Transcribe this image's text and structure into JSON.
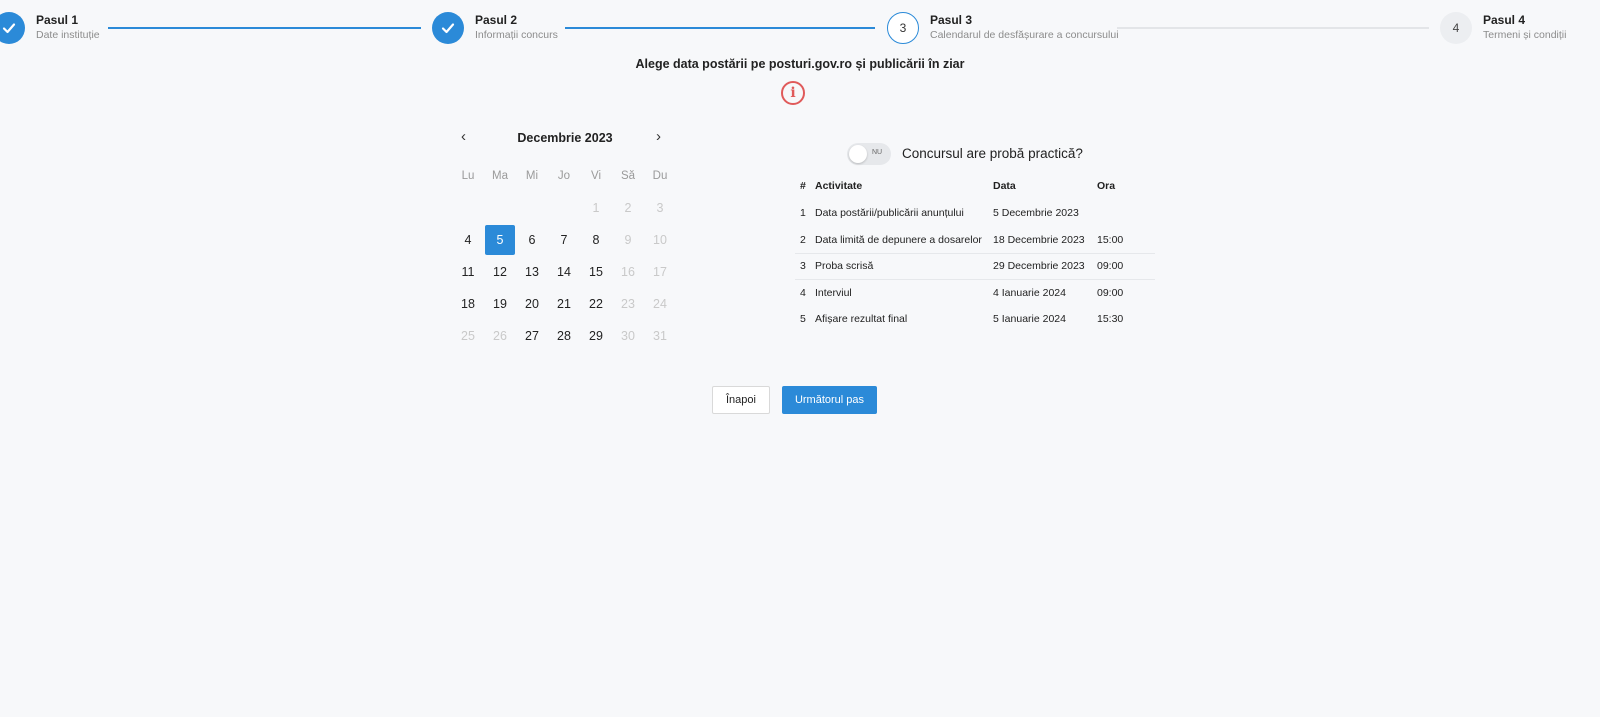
{
  "stepper": {
    "steps": [
      {
        "number": "1",
        "title": "Pasul 1",
        "subtitle": "Date instituție",
        "status": "done"
      },
      {
        "number": "2",
        "title": "Pasul 2",
        "subtitle": "Informații concurs",
        "status": "done"
      },
      {
        "number": "3",
        "title": "Pasul 3",
        "subtitle": "Calendarul de desfășurare a concursului",
        "status": "active"
      },
      {
        "number": "4",
        "title": "Pasul 4",
        "subtitle": "Termeni și condiții",
        "status": "todo"
      }
    ]
  },
  "heading": "Alege data postării pe posturi.gov.ro și publicării în ziar",
  "calendar": {
    "month_label": "Decembrie 2023",
    "prev_icon": "‹",
    "next_icon": "›",
    "weekdays": [
      "Lu",
      "Ma",
      "Mi",
      "Jo",
      "Vi",
      "Să",
      "Du"
    ],
    "weeks": [
      [
        null,
        null,
        null,
        null,
        "1",
        "2",
        "3"
      ],
      [
        "4",
        "5",
        "6",
        "7",
        "8",
        "9",
        "10"
      ],
      [
        "11",
        "12",
        "13",
        "14",
        "15",
        "16",
        "17"
      ],
      [
        "18",
        "19",
        "20",
        "21",
        "22",
        "23",
        "24"
      ],
      [
        "25",
        "26",
        "27",
        "28",
        "29",
        "30",
        "31"
      ]
    ],
    "enabled_days": [
      "4",
      "5",
      "6",
      "7",
      "8",
      "11",
      "12",
      "13",
      "14",
      "15",
      "18",
      "19",
      "20",
      "21",
      "22",
      "27",
      "28",
      "29"
    ],
    "selected_day": "5"
  },
  "practical_toggle": {
    "state_label": "NU",
    "question": "Concursul are probă practică?"
  },
  "schedule_table": {
    "headers": [
      "#",
      "Activitate",
      "Data",
      "Ora"
    ],
    "rows": [
      [
        "1",
        "Data postării/publicării anunțului",
        "5 Decembrie 2023",
        ""
      ],
      [
        "2",
        "Data limită de depunere a dosarelor",
        "18 Decembrie 2023",
        "15:00"
      ],
      [
        "3",
        "Proba scrisă",
        "29 Decembrie 2023",
        "09:00"
      ],
      [
        "4",
        "Interviul",
        "4 Ianuarie 2024",
        "09:00"
      ],
      [
        "5",
        "Afișare rezultat final",
        "5 Ianuarie 2024",
        "15:30"
      ]
    ]
  },
  "buttons": {
    "back_label": "Înapoi",
    "next_label": "Următorul pas"
  },
  "colors": {
    "accent": "#2b8ad8",
    "info_icon": "#e05a5a",
    "background": "#f7f8fa"
  },
  "icons": {
    "done_step": "check-icon",
    "info": "info-icon"
  }
}
